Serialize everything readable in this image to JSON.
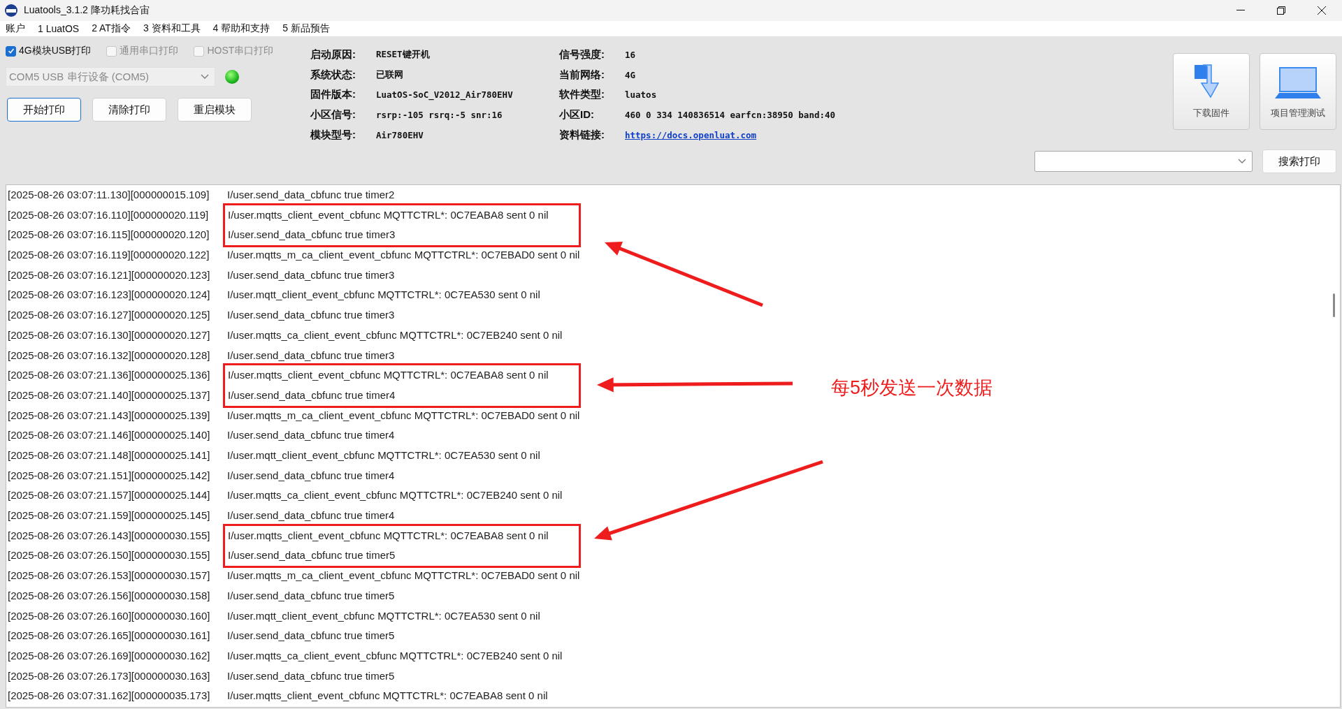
{
  "window": {
    "title": "Luatools_3.1.2 降功耗找合宙"
  },
  "menu": [
    "账户",
    "1 LuatOS",
    "2 AT指令",
    "3 资料和工具",
    "4 帮助和支持",
    "5 新品预告"
  ],
  "print_options": [
    {
      "label": "4G模块USB打印",
      "checked": true,
      "disabled": false
    },
    {
      "label": "通用串口打印",
      "checked": false,
      "disabled": true
    },
    {
      "label": "HOST串口打印",
      "checked": false,
      "disabled": true
    }
  ],
  "port_select": {
    "value": "COM5 USB 串行设备 (COM5)",
    "connected": true
  },
  "actions": [
    "开始打印",
    "清除打印",
    "重启模块"
  ],
  "info": [
    {
      "label": "启动原因:",
      "value": "RESET键开机"
    },
    {
      "label": "信号强度:",
      "value": "16"
    },
    {
      "label": "系统状态:",
      "value": "已联网"
    },
    {
      "label": "当前网络:",
      "value": "4G"
    },
    {
      "label": "固件版本:",
      "value": "LuatOS-SoC_V2012_Air780EHV"
    },
    {
      "label": "软件类型:",
      "value": "luatos"
    },
    {
      "label": "小区信号:",
      "value": "rsrp:-105 rsrq:-5 snr:16"
    },
    {
      "label": "小区ID:",
      "value": "460 0 334 140836514 earfcn:38950 band:40"
    },
    {
      "label": "模块型号:",
      "value": "Air780EHV"
    },
    {
      "label": "资料链接:",
      "value": "https://docs.openluat.com",
      "kind": "link"
    }
  ],
  "tools": [
    {
      "label": "下载固件",
      "kind": "download"
    },
    {
      "label": "项目管理测试",
      "kind": "project"
    }
  ],
  "search_button": "搜索打印",
  "log": [
    {
      "time": "[2025-08-26 03:07:11.130][000000015.109]",
      "message": "I/user.send_data_cbfunc true timer2",
      "boxed": false
    },
    {
      "time": "[2025-08-26 03:07:16.110][000000020.119]",
      "message": "I/user.mqtts_client_event_cbfunc MQTTCTRL*: 0C7EABA8 sent 0 nil",
      "boxed": true
    },
    {
      "time": "[2025-08-26 03:07:16.115][000000020.120]",
      "message": "I/user.send_data_cbfunc true timer3",
      "boxed": true
    },
    {
      "time": "[2025-08-26 03:07:16.119][000000020.122]",
      "message": "I/user.mqtts_m_ca_client_event_cbfunc MQTTCTRL*: 0C7EBAD0 sent 0 nil",
      "boxed": false
    },
    {
      "time": "[2025-08-26 03:07:16.121][000000020.123]",
      "message": "I/user.send_data_cbfunc true timer3",
      "boxed": false
    },
    {
      "time": "[2025-08-26 03:07:16.123][000000020.124]",
      "message": "I/user.mqtt_client_event_cbfunc MQTTCTRL*: 0C7EA530 sent 0 nil",
      "boxed": false
    },
    {
      "time": "[2025-08-26 03:07:16.127][000000020.125]",
      "message": "I/user.send_data_cbfunc true timer3",
      "boxed": false
    },
    {
      "time": "[2025-08-26 03:07:16.130][000000020.127]",
      "message": "I/user.mqtts_ca_client_event_cbfunc MQTTCTRL*: 0C7EB240 sent 0 nil",
      "boxed": false
    },
    {
      "time": "[2025-08-26 03:07:16.132][000000020.128]",
      "message": "I/user.send_data_cbfunc true timer3",
      "boxed": false
    },
    {
      "time": "[2025-08-26 03:07:21.136][000000025.136]",
      "message": "I/user.mqtts_client_event_cbfunc MQTTCTRL*: 0C7EABA8 sent 0 nil",
      "boxed": true
    },
    {
      "time": "[2025-08-26 03:07:21.140][000000025.137]",
      "message": "I/user.send_data_cbfunc true timer4",
      "boxed": true
    },
    {
      "time": "[2025-08-26 03:07:21.143][000000025.139]",
      "message": "I/user.mqtts_m_ca_client_event_cbfunc MQTTCTRL*: 0C7EBAD0 sent 0 nil",
      "boxed": false
    },
    {
      "time": "[2025-08-26 03:07:21.146][000000025.140]",
      "message": "I/user.send_data_cbfunc true timer4",
      "boxed": false
    },
    {
      "time": "[2025-08-26 03:07:21.148][000000025.141]",
      "message": "I/user.mqtt_client_event_cbfunc MQTTCTRL*: 0C7EA530 sent 0 nil",
      "boxed": false
    },
    {
      "time": "[2025-08-26 03:07:21.151][000000025.142]",
      "message": "I/user.send_data_cbfunc true timer4",
      "boxed": false
    },
    {
      "time": "[2025-08-26 03:07:21.157][000000025.144]",
      "message": "I/user.mqtts_ca_client_event_cbfunc MQTTCTRL*: 0C7EB240 sent 0 nil",
      "boxed": false
    },
    {
      "time": "[2025-08-26 03:07:21.159][000000025.145]",
      "message": "I/user.send_data_cbfunc true timer4",
      "boxed": false
    },
    {
      "time": "[2025-08-26 03:07:26.143][000000030.155]",
      "message": "I/user.mqtts_client_event_cbfunc MQTTCTRL*: 0C7EABA8 sent 0 nil",
      "boxed": true
    },
    {
      "time": "[2025-08-26 03:07:26.150][000000030.155]",
      "message": "I/user.send_data_cbfunc true timer5",
      "boxed": true
    },
    {
      "time": "[2025-08-26 03:07:26.153][000000030.157]",
      "message": "I/user.mqtts_m_ca_client_event_cbfunc MQTTCTRL*: 0C7EBAD0 sent 0 nil",
      "boxed": false
    },
    {
      "time": "[2025-08-26 03:07:26.156][000000030.158]",
      "message": "I/user.send_data_cbfunc true timer5",
      "boxed": false
    },
    {
      "time": "[2025-08-26 03:07:26.160][000000030.160]",
      "message": "I/user.mqtt_client_event_cbfunc MQTTCTRL*: 0C7EA530 sent 0 nil",
      "boxed": false
    },
    {
      "time": "[2025-08-26 03:07:26.165][000000030.161]",
      "message": "I/user.send_data_cbfunc true timer5",
      "boxed": false
    },
    {
      "time": "[2025-08-26 03:07:26.169][000000030.162]",
      "message": "I/user.mqtts_ca_client_event_cbfunc MQTTCTRL*: 0C7EB240 sent 0 nil",
      "boxed": false
    },
    {
      "time": "[2025-08-26 03:07:26.173][000000030.163]",
      "message": "I/user.send_data_cbfunc true timer5",
      "boxed": false
    },
    {
      "time": "[2025-08-26 03:07:31.162][000000035.173]",
      "message": "I/user.mqtts_client_event_cbfunc MQTTCTRL*: 0C7EABA8 sent 0 nil",
      "boxed": false
    }
  ],
  "annotation": {
    "label": "每5秒发送一次数据"
  }
}
